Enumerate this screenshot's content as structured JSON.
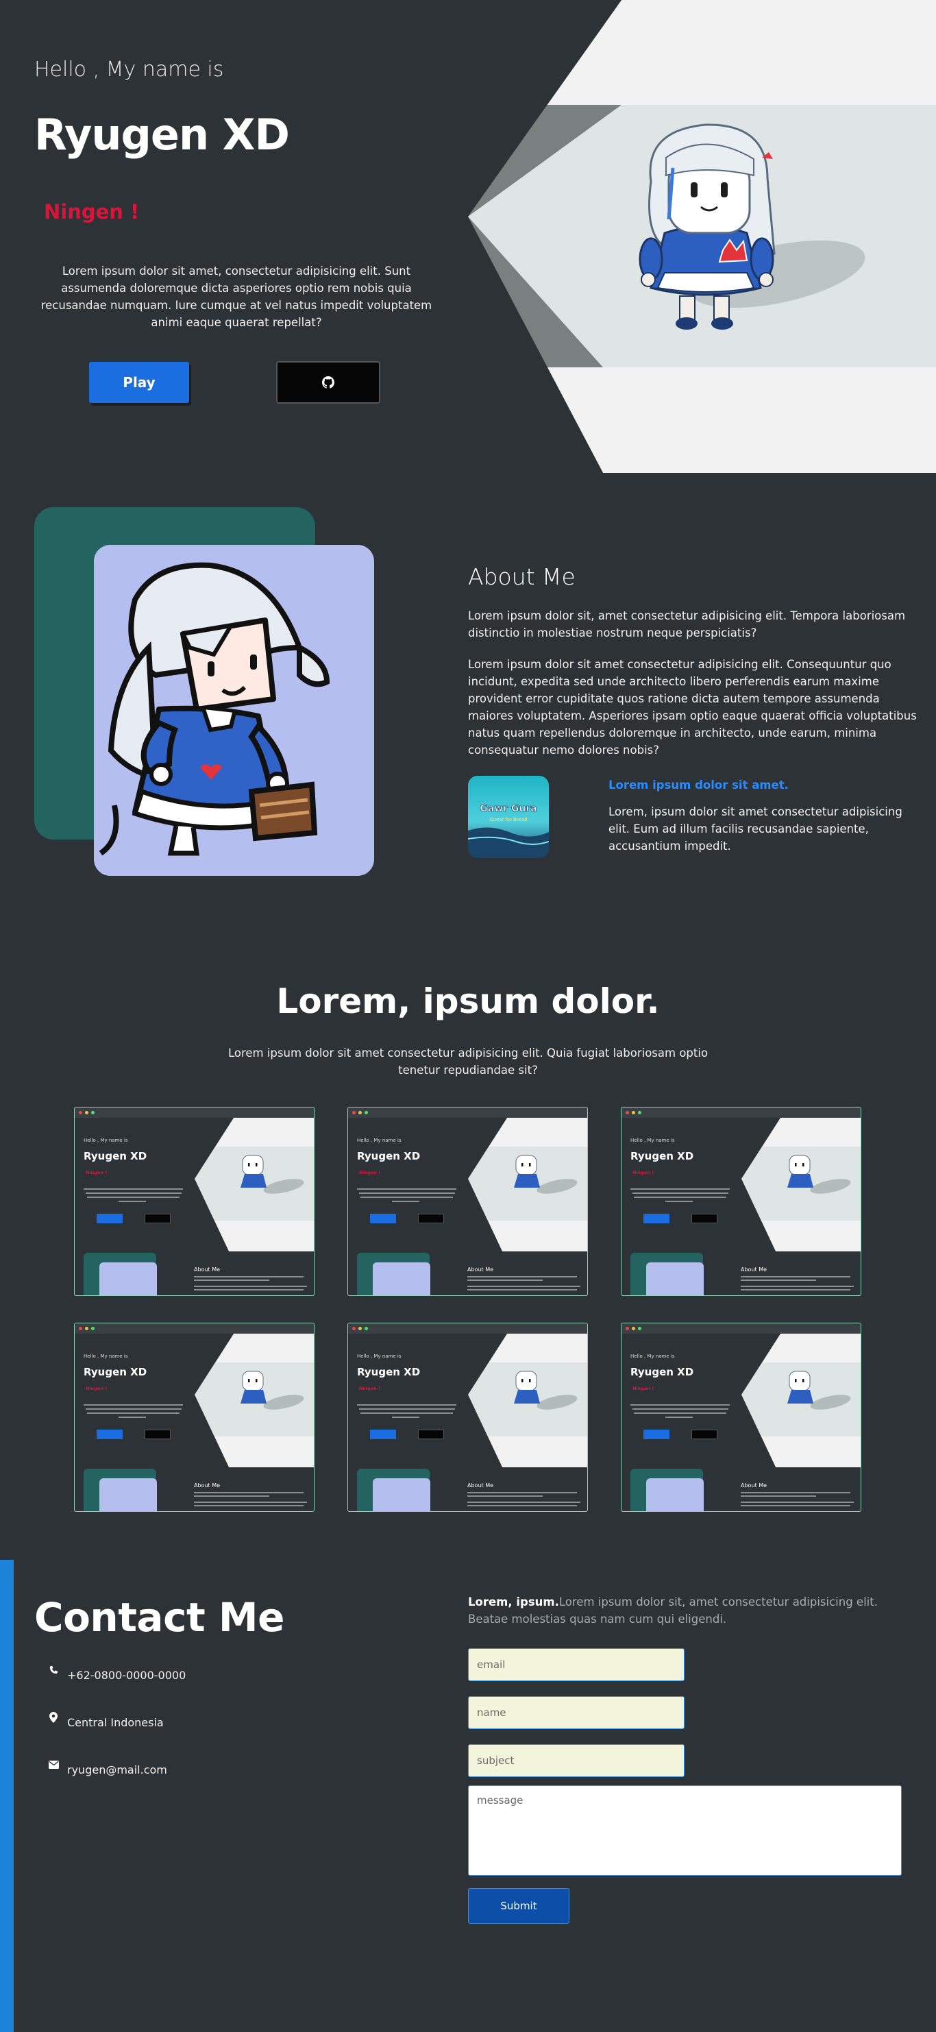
{
  "hero": {
    "greeting": "Hello , My name is",
    "name": "Ryugen XD",
    "role": "Ningen !",
    "description": "Lorem ipsum dolor sit amet, consectetur adipisicing elit. Sunt assumenda doloremque dicta asperiores optio rem nobis quia recusandae numquam. Iure cumque at vel natus impedit voluptatem animi eaque quaerat repellat?",
    "play_label": "Play",
    "github_icon": "github-icon"
  },
  "about": {
    "title": "About Me",
    "paragraph1": "Lorem ipsum dolor sit, amet consectetur adipisicing elit. Tempora laboriosam distinctio in molestiae nostrum neque perspiciatis?",
    "paragraph2": "Lorem ipsum dolor sit amet consectetur adipisicing elit. Consequuntur quo incidunt, expedita sed unde architecto libero perferendis earum maxime provident error cupiditate quos ratione dicta autem tempore assumenda maiores voluptatem. Asperiores ipsam optio eaque quaerat officia voluptatibus natus quam repellendus doloremque in architecto, unde earum, minima consequatur nemo dolores nobis?",
    "sub_title": "Lorem ipsum dolor sit amet.",
    "sub_description": "Lorem, ipsum dolor sit amet consectetur adipisicing elit. Eum ad illum facilis recusandae sapiente, accusantium impedit.",
    "game_logo_text": "Gawr Gura",
    "game_logo_subtext": "Quest for Bread"
  },
  "portfolio": {
    "title": "Lorem, ipsum dolor.",
    "description": "Lorem ipsum dolor sit amet consectetur adipisicing elit. Quia fugiat laboriosam optio tenetur repudiandae sit?",
    "cards": [
      {
        "greeting": "Hello , My name is",
        "name": "Ryugen XD",
        "role": "Ningen !",
        "about": "About Me"
      },
      {
        "greeting": "Hello , My name is",
        "name": "Ryugen XD",
        "role": "Ningen !",
        "about": "About Me"
      },
      {
        "greeting": "Hello , My name is",
        "name": "Ryugen XD",
        "role": "Ningen !",
        "about": "About Me"
      },
      {
        "greeting": "Hello , My name is",
        "name": "Ryugen XD",
        "role": "Ningen !",
        "about": "About Me"
      },
      {
        "greeting": "Hello , My name is",
        "name": "Ryugen XD",
        "role": "Ningen !",
        "about": "About Me"
      },
      {
        "greeting": "Hello , My name is",
        "name": "Ryugen XD",
        "role": "Ningen !",
        "about": "About Me"
      }
    ]
  },
  "contact": {
    "title": "Contact Me",
    "phone": "+62-0800-0000-0000",
    "location": "Central Indonesia",
    "email": "ryugen@mail.com",
    "intro_bold": "Lorem, ipsum.",
    "intro_text": "Lorem ipsum dolor sit, amet consectetur adipisicing elit. Beatae molestias quas nam cum qui eligendi.",
    "email_placeholder": "email",
    "name_placeholder": "name",
    "subject_placeholder": "subject",
    "message_placeholder": "message",
    "submit_label": "Submit"
  },
  "colors": {
    "background": "#2d3236",
    "accent_red": "#d9163a",
    "accent_blue": "#1b6ee0",
    "teal": "#236360",
    "lavender": "#b5bfef",
    "sidebar_blue": "#1d83d9"
  }
}
